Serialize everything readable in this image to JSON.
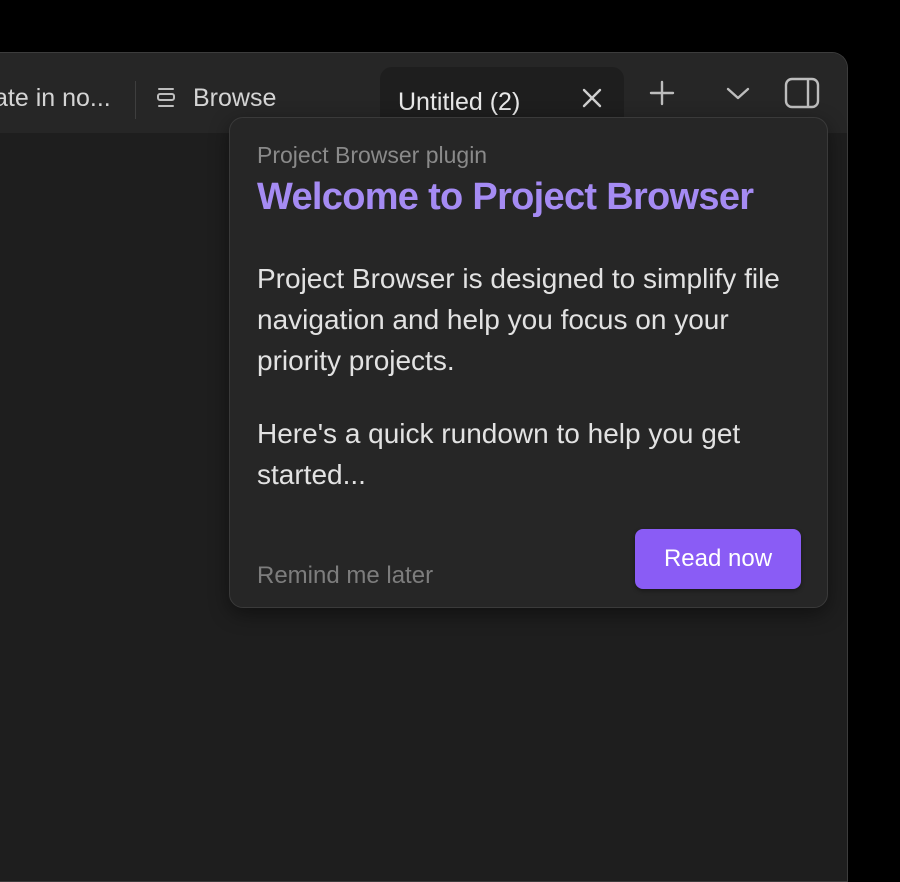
{
  "tabbar": {
    "tabs": [
      {
        "label": "ate in no..."
      },
      {
        "label": "Browse",
        "icon": "project-browser-icon"
      },
      {
        "label": "Untitled (2)",
        "active": true
      }
    ],
    "actions": {
      "new_tab_icon": "plus-icon",
      "tab_list_icon": "chevron-down-icon",
      "sidebar_toggle_icon": "sidebar-toggle-icon"
    }
  },
  "popover": {
    "kicker": "Project Browser plugin",
    "title": "Welcome to Project Browser",
    "paragraphs": [
      "Project Browser is designed to simplify file navigation and help you focus on your priority projects.",
      "Here's a quick rundown to help you get started..."
    ],
    "remind_label": "Remind me later",
    "read_label": "Read now"
  },
  "colors": {
    "accent": "#8a5cf5",
    "title": "#a58bf3",
    "background": "#1e1e1e",
    "tabbar": "#262626"
  }
}
